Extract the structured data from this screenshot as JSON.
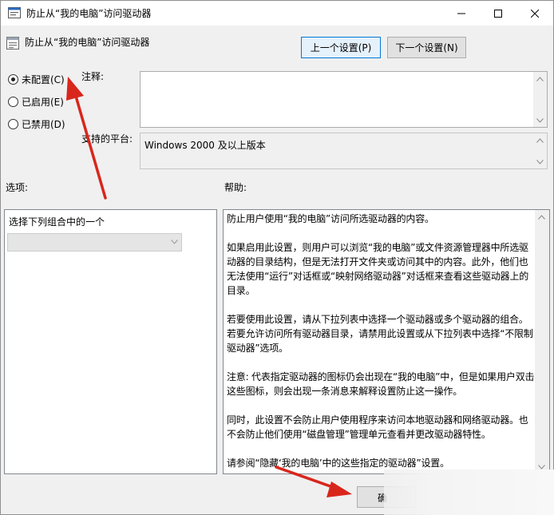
{
  "window": {
    "title": "防止从“我的电脑”访问驱动器"
  },
  "header": {
    "setting_name": "防止从“我的电脑”访问驱动器",
    "prev_button": "上一个设置(P)",
    "next_button": "下一个设置(N)"
  },
  "state": {
    "options": [
      {
        "label": "未配置(C)",
        "checked": true
      },
      {
        "label": "已启用(E)",
        "checked": false
      },
      {
        "label": "已禁用(D)",
        "checked": false
      }
    ]
  },
  "comment": {
    "label": "注释:",
    "value": ""
  },
  "platform": {
    "label": "支持的平台:",
    "value": "Windows 2000 及以上版本"
  },
  "options_pane": {
    "label": "选项:",
    "combo_caption": "选择下列组合中的一个",
    "combo_value": ""
  },
  "help_pane": {
    "label": "帮助:",
    "paragraphs": [
      "防止用户使用“我的电脑”访问所选驱动器的内容。",
      "如果启用此设置，则用户可以浏览“我的电脑”或文件资源管理器中所选驱动器的目录结构，但是无法打开文件夹或访问其中的内容。此外，他们也无法使用“运行”对话框或“映射网络驱动器”对话框来查看这些驱动器上的目录。",
      "若要使用此设置，请从下拉列表中选择一个驱动器或多个驱动器的组合。若要允许访问所有驱动器目录，请禁用此设置或从下拉列表中选择“不限制驱动器”选项。",
      "注意: 代表指定驱动器的图标仍会出现在“我的电脑”中，但是如果用户双击这些图标，则会出现一条消息来解释设置防止这一操作。",
      " 同时，此设置不会防止用户使用程序来访问本地驱动器和网络驱动器。也不会防止他们使用“磁盘管理”管理单元查看并更改驱动器特性。",
      "请参阅“隐藏‘我的电脑’中的这些指定的驱动器”设置。"
    ]
  },
  "footer": {
    "confirm_button": "确"
  },
  "colors": {
    "annotation_arrow": "#d9261c",
    "focus_border": "#0078d7"
  }
}
